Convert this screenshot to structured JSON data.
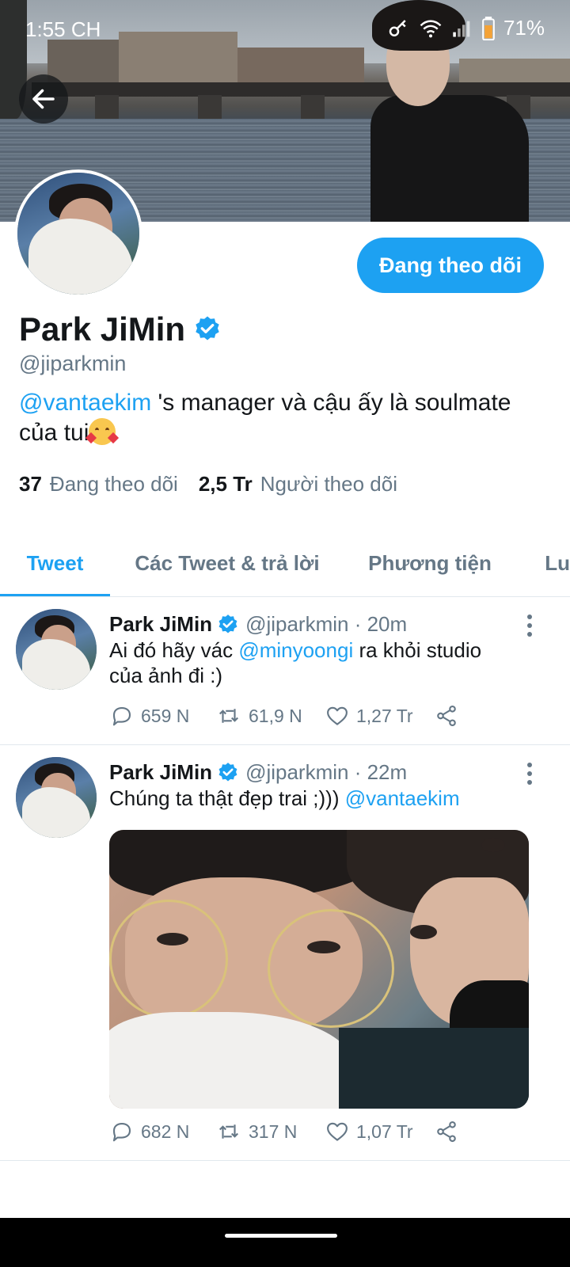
{
  "status_bar": {
    "time": "1:55 CH",
    "battery": "71%"
  },
  "profile": {
    "name": "Park JiMin",
    "handle": "@jiparkmin",
    "follow_button": "Đang theo dõi",
    "bio_mention": "@vantaekim",
    "bio_text_1": " 's manager và cậu ấy là soulmate",
    "bio_text_2": "của tui",
    "following_count": "37",
    "following_label": "Đang theo dõi",
    "followers_count": "2,5 Tr",
    "followers_label": "Người theo dõi"
  },
  "tabs": [
    {
      "label": "Tweet",
      "active": true
    },
    {
      "label": "Các Tweet & trả lời",
      "active": false
    },
    {
      "label": "Phương tiện",
      "active": false
    },
    {
      "label": "Lu",
      "active": false
    }
  ],
  "tweets": [
    {
      "name": "Park JiMin",
      "meta": "@jiparkmin · 20m",
      "text_1": "Ai đó hãy vác ",
      "mention": "@minyoongi",
      "text_2": " ra khỏi studio",
      "text_3": "của ảnh đi :)",
      "replies": "659 N",
      "retweets": "61,9 N",
      "likes": "1,27 Tr"
    },
    {
      "name": "Park JiMin",
      "meta": "@jiparkmin · 22m",
      "text_1": "Chúng ta thật đẹp trai ;))) ",
      "mention": "@vantaekim",
      "replies": "682 N",
      "retweets": "317 N",
      "likes": "1,07 Tr"
    }
  ],
  "colors": {
    "accent": "#1da1f2",
    "muted": "#657786",
    "text": "#14171a"
  }
}
